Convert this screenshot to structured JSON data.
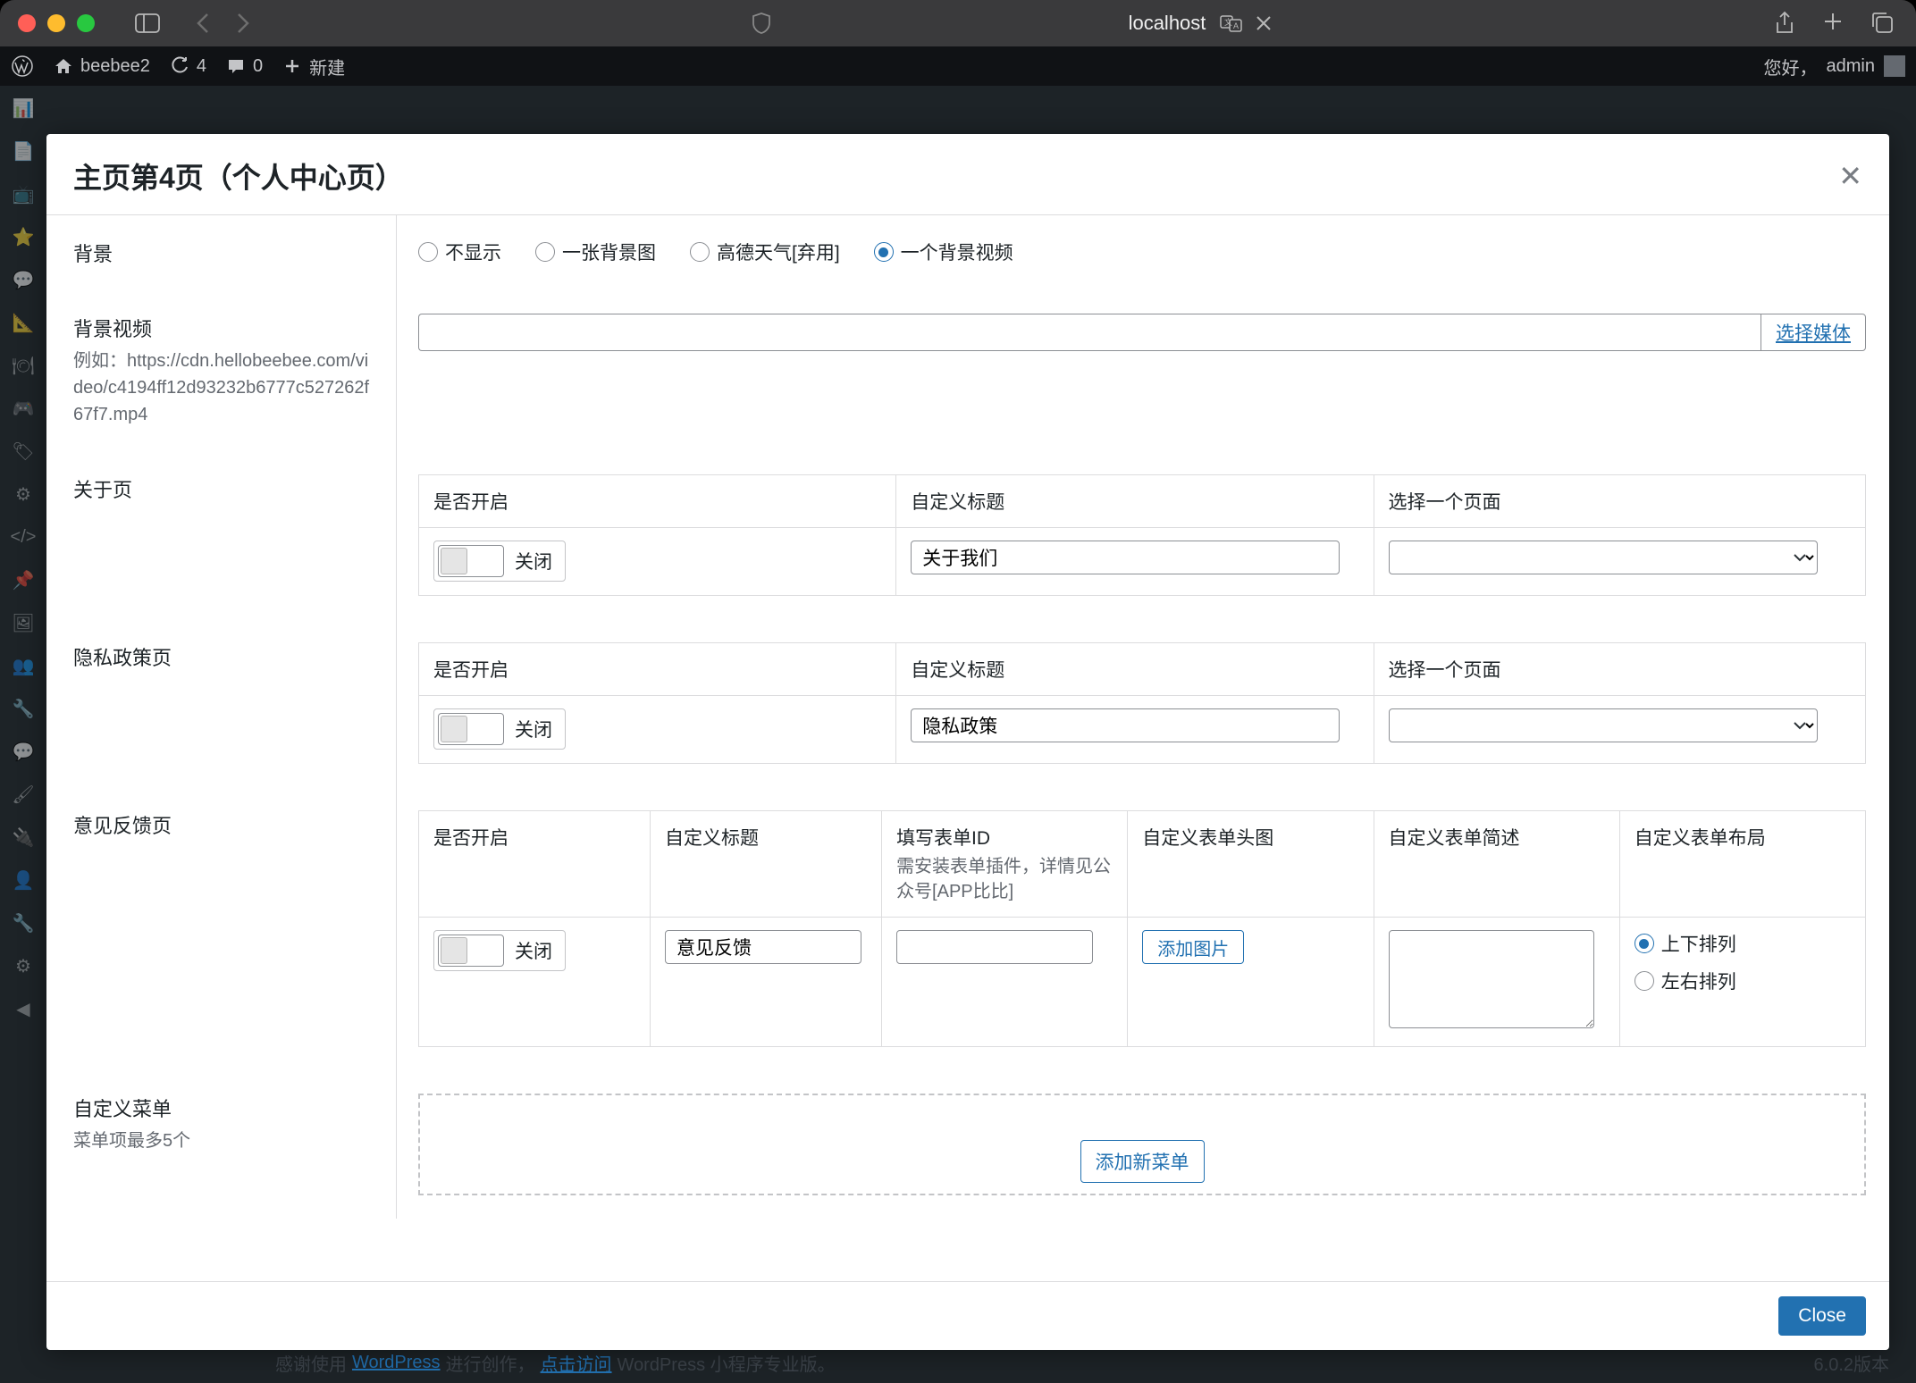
{
  "browser": {
    "url": "localhost"
  },
  "adminbar": {
    "site_name": "beebee2",
    "updates_count": "4",
    "comments_count": "0",
    "new_label": "新建",
    "greeting": "您好，",
    "username": "admin"
  },
  "modal": {
    "title": "主页第4页（个人中心页）",
    "close_label": "Close"
  },
  "rows": {
    "background": {
      "label": "背景",
      "options": {
        "none": "不显示",
        "image": "一张背景图",
        "gaode": "高德天气[弃用]",
        "video": "一个背景视频"
      }
    },
    "bgvideo": {
      "label": "背景视频",
      "example_prefix": "例如：",
      "example_url": "https://cdn.hellobeebee.com/video/c4194ff12d93232b6777c527262f67f7.mp4",
      "select_media": "选择媒体",
      "value": ""
    },
    "about": {
      "label": "关于页",
      "col_enable": "是否开启",
      "col_title": "自定义标题",
      "col_page": "选择一个页面",
      "toggle_state": "关闭",
      "title_value": "关于我们"
    },
    "privacy": {
      "label": "隐私政策页",
      "col_enable": "是否开启",
      "col_title": "自定义标题",
      "col_page": "选择一个页面",
      "toggle_state": "关闭",
      "title_value": "隐私政策"
    },
    "feedback": {
      "label": "意见反馈页",
      "col_enable": "是否开启",
      "col_title": "自定义标题",
      "col_formid": "填写表单ID",
      "col_formid_desc": "需安装表单插件，详情见公众号[APP比比]",
      "col_header_img": "自定义表单头图",
      "col_desc": "自定义表单简述",
      "col_layout": "自定义表单布局",
      "toggle_state": "关闭",
      "title_value": "意见反馈",
      "formid_value": "",
      "add_image": "添加图片",
      "desc_value": "",
      "layout_vertical": "上下排列",
      "layout_horizontal": "左右排列"
    },
    "custom_menu": {
      "label": "自定义菜单",
      "sub": "菜单项最多5个",
      "add_button": "添加新菜单"
    }
  },
  "footer": {
    "thanks_pre": "感谢使用 ",
    "wp_link": "WordPress",
    "thanks_mid": " 进行创作，",
    "click_link": "点击访问",
    "thanks_suf": " WordPress 小程序专业版。",
    "version": "6.0.2版本"
  }
}
